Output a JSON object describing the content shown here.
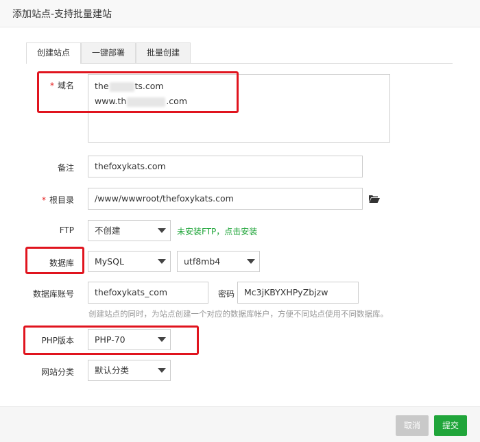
{
  "dialog": {
    "title": "添加站点-支持批量建站"
  },
  "tabs": [
    {
      "label": "创建站点",
      "active": true
    },
    {
      "label": "一键部署",
      "active": false
    },
    {
      "label": "批量创建",
      "active": false
    }
  ],
  "form": {
    "required_mark": "*",
    "domain": {
      "label": "域名",
      "line1_prefix": "the",
      "line1_suffix": "ts.com",
      "line2_prefix": "www.th",
      "line2_suffix": ".com"
    },
    "remark": {
      "label": "备注",
      "value": "thefoxykats.com"
    },
    "root_dir": {
      "label": "根目录",
      "value": "/www/wwwroot/thefoxykats.com",
      "icon": "folder-open-icon"
    },
    "ftp": {
      "label": "FTP",
      "selected": "不创建",
      "hint": "未安装FTP，点击安装"
    },
    "database": {
      "label": "数据库",
      "type_selected": "MySQL",
      "charset_selected": "utf8mb4"
    },
    "db_account": {
      "label": "数据库账号",
      "value": "thefoxykats_com",
      "password_label": "密码",
      "password_value": "Mc3jKBYXHPyZbjzw",
      "hint": "创建站点的同时，为站点创建一个对应的数据库帐户，方便不同站点使用不同数据库。"
    },
    "php_version": {
      "label": "PHP版本",
      "selected": "PHP-70"
    },
    "site_category": {
      "label": "网站分类",
      "selected": "默认分类"
    }
  },
  "footer": {
    "cancel_label": "取消",
    "submit_label": "提交"
  },
  "colors": {
    "accent": "#20a53a",
    "required": "#e41a1a",
    "highlight": "#e0141e",
    "disabled": "#c9c9c9"
  }
}
